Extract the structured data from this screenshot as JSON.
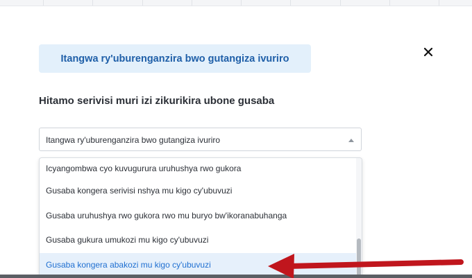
{
  "modal": {
    "selected_service_label": "Itangwa ry'uburenganzira bwo gutangiza ivuriro",
    "instruction": "Hitamo serivisi muri izi zikurikira ubone gusaba",
    "close_symbol": "✕",
    "close_icon": "close-icon",
    "select": {
      "value": "Itangwa ry'uburenganzira bwo gutangiza ivuriro",
      "caret_icon": "caret-up-icon"
    },
    "options": [
      "Icyangombwa cyo kuvugurura uruhushya rwo gukora",
      "Gusaba kongera serivisi nshya mu kigo cy'ubuvuzi",
      "Gusaba uruhushya rwo gukora rwo mu buryo bw'ikoranabuhanga",
      "Gusaba gukura umukozi mu kigo cy'ubuvuzi",
      "Gusaba kongera abakozi mu kigo cy'ubuvuzi"
    ],
    "highlighted_option_index": 4
  },
  "annotation": {
    "arrow_color": "#c0161d",
    "arrow_icon": "red-arrow-pointer"
  },
  "colors": {
    "chip_background": "#e3f0fb",
    "chip_text": "#1f5fa8",
    "highlight_background": "#e6f0fb",
    "highlight_text": "#1f6fd1"
  }
}
